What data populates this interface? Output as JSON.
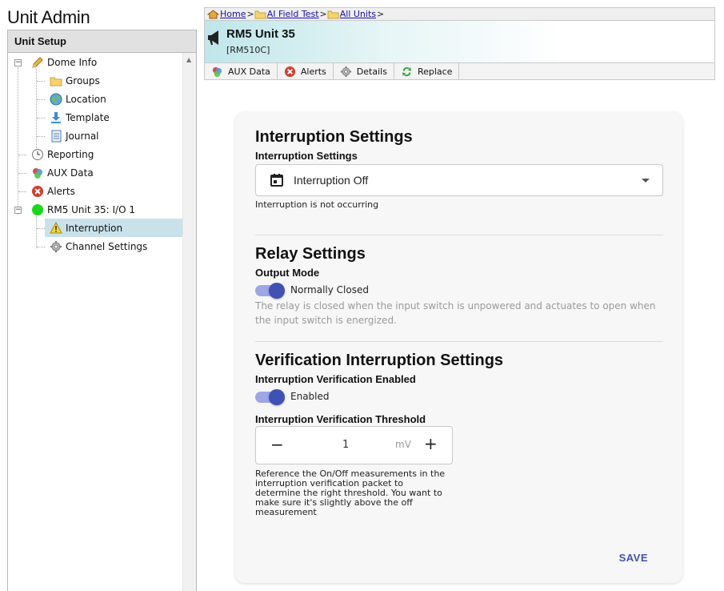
{
  "app": {
    "title": "Unit Admin"
  },
  "left_panel": {
    "header": "Unit Setup",
    "items": [
      {
        "label": "Dome Info",
        "icon": "pencil-icon"
      },
      {
        "label": "Groups",
        "icon": "folder-icon"
      },
      {
        "label": "Location",
        "icon": "globe-icon"
      },
      {
        "label": "Template",
        "icon": "download-icon"
      },
      {
        "label": "Journal",
        "icon": "journal-icon"
      },
      {
        "label": "Reporting",
        "icon": "clock-icon"
      },
      {
        "label": "AUX Data",
        "icon": "aux-data-icon"
      },
      {
        "label": "Alerts",
        "icon": "alert-icon"
      },
      {
        "label": "RM5 Unit 35: I/O 1",
        "icon": "status-dot-icon"
      },
      {
        "label": "Interruption",
        "icon": "warning-icon",
        "selected": true
      },
      {
        "label": "Channel Settings",
        "icon": "gear-icon"
      }
    ]
  },
  "breadcrumb": {
    "items": [
      "Home",
      "AI Field Test",
      "All Units"
    ],
    "separator": ">"
  },
  "unit": {
    "name": "RM5 Unit 35",
    "model": "[RM510C]"
  },
  "toolbar": {
    "buttons": [
      "AUX Data",
      "Alerts",
      "Details",
      "Replace"
    ]
  },
  "interruption": {
    "heading": "Interruption Settings",
    "label": "Interruption Settings",
    "selected": "Interruption Off",
    "status": "Interruption is not occurring"
  },
  "relay": {
    "heading": "Relay Settings",
    "label": "Output Mode",
    "toggle_label": "Normally Closed",
    "toggle_on": true,
    "description": "The relay is closed when the input switch is unpowered and actuates to open when the input switch is energized."
  },
  "verification": {
    "heading": "Verification Interruption Settings",
    "enabled_label": "Interruption Verification Enabled",
    "toggle_label": "Enabled",
    "toggle_on": true,
    "threshold_label": "Interruption Verification Threshold",
    "threshold_value": "1",
    "threshold_unit": "mV",
    "help": "Reference the On/Off measurements in the interruption verification packet to determine the right threshold. You want to make sure it's slightly above the off measurement"
  },
  "actions": {
    "save": "SAVE"
  },
  "colors": {
    "accent": "#3f51b5",
    "toggle_track": "#9fa6e6",
    "selected_row": "#c9e2ea"
  }
}
